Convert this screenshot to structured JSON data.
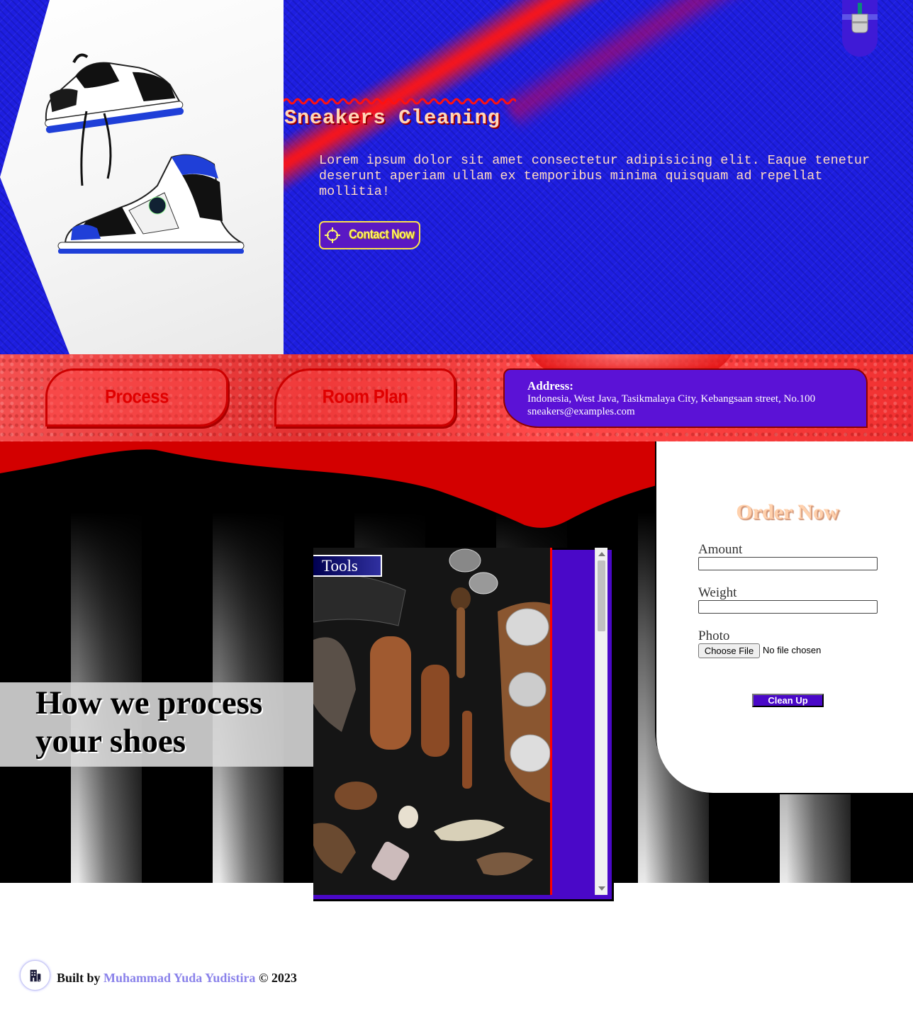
{
  "hero": {
    "title": "Sneakers Cleaning",
    "description": "Lorem ipsum dolor sit amet consectetur adipisicing elit. Eaque tenetur deserunt aperiam ullam ex temporibus minima quisquam ad repellat mollitia!",
    "contact_button": "Contact Now",
    "contact_icon": "crosshair-icon",
    "corner_icon": "paint-brush-icon"
  },
  "nav": {
    "process_label": "Process",
    "room_plan_label": "Room Plan"
  },
  "address": {
    "title": "Address:",
    "line": "Indonesia, West Java, Tasikmalaya City, Kebangsaan street, No.100",
    "email": "sneakers@examples.com"
  },
  "process": {
    "title": "How we process your shoes",
    "tools_label": "Tools"
  },
  "order": {
    "title": "Order Now",
    "amount_label": "Amount",
    "amount_value": "",
    "weight_label": "Weight",
    "weight_value": "",
    "photo_label": "Photo",
    "file_button": "Choose File",
    "file_status": "No file chosen",
    "submit_label": "Clean Up"
  },
  "footer": {
    "prefix": "Built by",
    "author": "Muhammad Yuda Yudistira",
    "suffix": "© 2023",
    "icon": "building-icon"
  },
  "colors": {
    "hero_blue": "#1e1ee0",
    "accent_red": "#ff0000",
    "accent_purple": "#4a08c8",
    "title_peach": "#ffd7b8",
    "button_yellow": "#ffe24a"
  }
}
